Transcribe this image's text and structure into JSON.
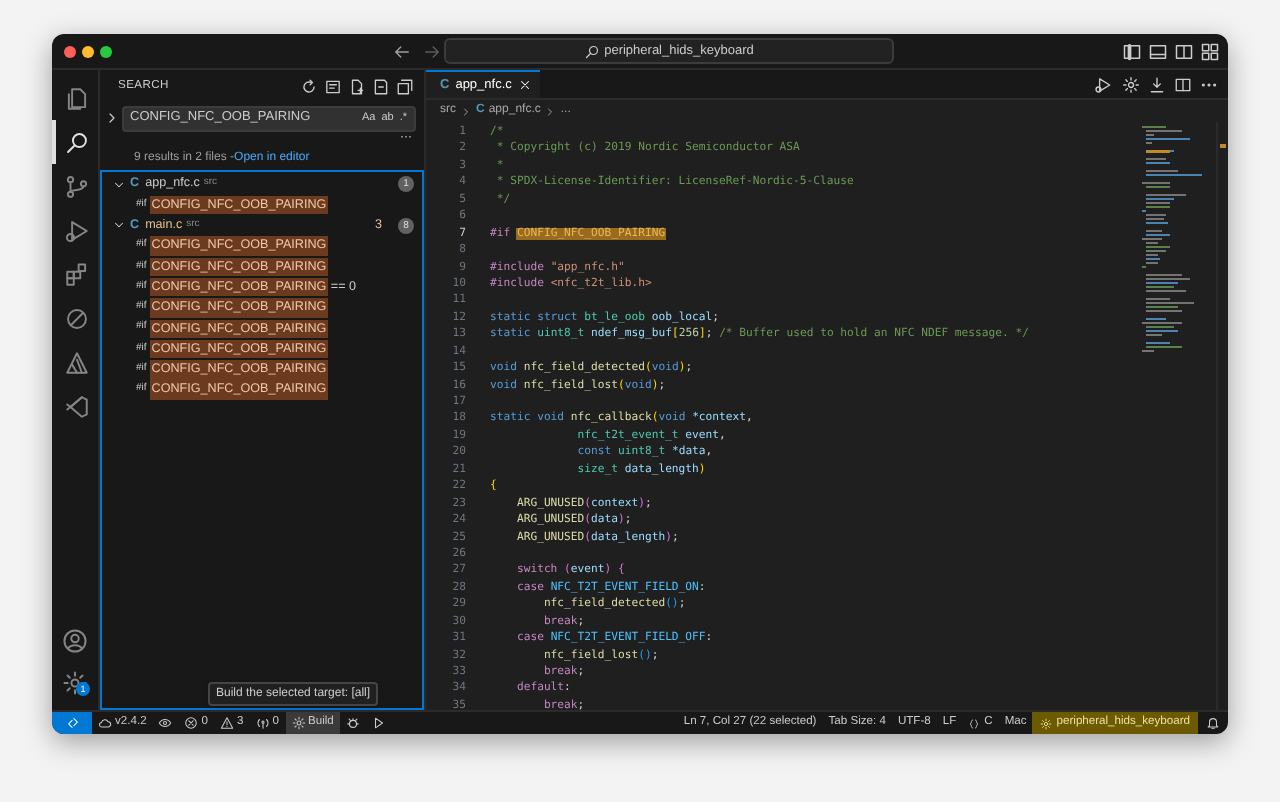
{
  "title_bar": {
    "search": "peripheral_hids_keyboard"
  },
  "activity_bar": {
    "items": [
      {
        "kind": "files",
        "selected": false
      },
      {
        "kind": "search",
        "selected": true
      },
      {
        "kind": "source-control",
        "selected": false
      },
      {
        "kind": "run-debug",
        "selected": false
      },
      {
        "kind": "extensions",
        "selected": false
      },
      {
        "kind": "remote",
        "selected": false
      },
      {
        "kind": "triangle",
        "selected": false
      },
      {
        "kind": "ribbon",
        "selected": false
      }
    ],
    "account": {
      "kind": "account"
    },
    "settings": {
      "badge": "1"
    }
  },
  "sidebar": {
    "title": "SEARCH",
    "search": {
      "replace_expanded": false,
      "value": "CONFIG_NFC_OOB_PAIRING",
      "options": [
        "Aa",
        "ab",
        ".*"
      ]
    },
    "more": "···",
    "summary": "9 results in 2 files - ",
    "open_link": "Open in editor",
    "results": [
      {
        "file_icon": "C",
        "file": "app_nfc.c",
        "folder": "src",
        "modified": false,
        "count": "1",
        "expanded": true,
        "matches": [
          {
            "prefix": "#if",
            "match": "CONFIG_NFC_OOB_PAIRING"
          }
        ]
      },
      {
        "file_icon": "C",
        "file": "main.c",
        "folder": "src",
        "modified": true,
        "problems": "3",
        "count": "8",
        "expanded": true,
        "matches": [
          {
            "prefix": "#if",
            "match": "CONFIG_NFC_OOB_PAIRING"
          },
          {
            "prefix": "#if",
            "match": "CONFIG_NFC_OOB_PAIRING"
          },
          {
            "prefix": "#if",
            "match": "CONFIG_NFC_OOB_PAIRING",
            "suffix": " == 0"
          },
          {
            "prefix": "#if",
            "match": "CONFIG_NFC_OOB_PAIRING"
          },
          {
            "prefix": "#if",
            "match": "CONFIG_NFC_OOB_PAIRING"
          },
          {
            "prefix": "#if",
            "match": "CONFIG_NFC_OOB_PAIRING"
          },
          {
            "prefix": "#if",
            "match": "CONFIG_NFC_OOB_PAIRING"
          },
          {
            "prefix": "#if",
            "match": "CONFIG_NFC_OOB_PAIRING"
          }
        ]
      }
    ]
  },
  "editor": {
    "tabs": [
      {
        "file_icon": "C",
        "label": "app_nfc.c",
        "selected": true
      }
    ],
    "breadcrumbs": [
      {
        "kind": "folder",
        "text": "src"
      },
      {
        "kind": "file",
        "icon": "C",
        "text": "app_nfc.c"
      },
      {
        "kind": "more",
        "text": "..."
      }
    ],
    "lines": [
      {
        "number": "1",
        "current": false,
        "tokens": [
          {
            "text": "/*",
            "kind": "comment"
          }
        ]
      },
      {
        "number": "2",
        "current": false,
        "tokens": [
          {
            "text": " * Copyright (c) 2019 Nordic Semiconductor ASA",
            "kind": "comment"
          }
        ]
      },
      {
        "number": "3",
        "current": false,
        "tokens": [
          {
            "text": " *",
            "kind": "comment"
          }
        ]
      },
      {
        "number": "4",
        "current": false,
        "tokens": [
          {
            "text": " * SPDX-License-Identifier: LicenseRef-Nordic-5-Clause",
            "kind": "comment"
          }
        ]
      },
      {
        "number": "5",
        "current": false,
        "tokens": [
          {
            "text": " */",
            "kind": "comment"
          }
        ]
      },
      {
        "number": "6",
        "current": false
      },
      {
        "number": "7",
        "current": true,
        "tokens": [
          {
            "text": "#if ",
            "kind": "directive"
          },
          {
            "text": "CONFIG_NFC_OOB_PAIRING",
            "kind": "match"
          }
        ]
      },
      {
        "number": "8",
        "current": false
      },
      {
        "number": "9",
        "current": false,
        "tokens": [
          {
            "text": "#include ",
            "kind": "directive"
          },
          {
            "text": "\"app_nfc.h\"",
            "kind": "string"
          }
        ]
      },
      {
        "number": "10",
        "current": false,
        "tokens": [
          {
            "text": "#include ",
            "kind": "directive"
          },
          {
            "text": "<nfc_t2t_lib.h>",
            "kind": "string"
          }
        ]
      },
      {
        "number": "11",
        "current": false
      },
      {
        "number": "12",
        "current": false,
        "tokens": [
          {
            "text": "static struct ",
            "kind": "keyword"
          },
          {
            "text": "bt_le_oob ",
            "kind": "type"
          },
          {
            "text": "oob_local",
            "kind": "variable"
          },
          {
            "text": ";",
            "kind": "plain"
          }
        ]
      },
      {
        "number": "13",
        "current": false,
        "tokens": [
          {
            "text": "static ",
            "kind": "keyword"
          },
          {
            "text": "uint8_t ",
            "kind": "type"
          },
          {
            "text": "ndef_msg_buf",
            "kind": "variable"
          },
          {
            "text": "[",
            "kind": "bracket"
          },
          {
            "text": "256",
            "kind": "number"
          },
          {
            "text": "]",
            "kind": "bracket"
          },
          {
            "text": "; ",
            "kind": "plain"
          },
          {
            "text": "/* Buffer used to hold an NFC NDEF message. */",
            "kind": "comment"
          }
        ]
      },
      {
        "number": "14",
        "current": false
      },
      {
        "number": "15",
        "current": false,
        "tokens": [
          {
            "text": "void ",
            "kind": "keyword"
          },
          {
            "text": "nfc_field_detected",
            "kind": "function"
          },
          {
            "text": "(",
            "kind": "bracket"
          },
          {
            "text": "void",
            "kind": "keyword"
          },
          {
            "text": ")",
            "kind": "bracket"
          },
          {
            "text": ";",
            "kind": "plain"
          }
        ]
      },
      {
        "number": "16",
        "current": false,
        "tokens": [
          {
            "text": "void ",
            "kind": "keyword"
          },
          {
            "text": "nfc_field_lost",
            "kind": "function"
          },
          {
            "text": "(",
            "kind": "bracket"
          },
          {
            "text": "void",
            "kind": "keyword"
          },
          {
            "text": ")",
            "kind": "bracket"
          },
          {
            "text": ";",
            "kind": "plain"
          }
        ]
      },
      {
        "number": "17",
        "current": false
      },
      {
        "number": "18",
        "current": false,
        "tokens": [
          {
            "text": "static void ",
            "kind": "keyword"
          },
          {
            "text": "nfc_callback",
            "kind": "function"
          },
          {
            "text": "(",
            "kind": "bracket"
          },
          {
            "text": "void ",
            "kind": "keyword"
          },
          {
            "text": "*context",
            "kind": "variable"
          },
          {
            "text": ",",
            "kind": "plain"
          }
        ]
      },
      {
        "number": "19",
        "current": false,
        "tokens": [
          {
            "text": "             nfc_t2t_event_t ",
            "kind": "type"
          },
          {
            "text": "event",
            "kind": "variable"
          },
          {
            "text": ",",
            "kind": "plain"
          }
        ]
      },
      {
        "number": "20",
        "current": false,
        "tokens": [
          {
            "text": "             const ",
            "kind": "keyword"
          },
          {
            "text": "uint8_t ",
            "kind": "type"
          },
          {
            "text": "*data",
            "kind": "variable"
          },
          {
            "text": ",",
            "kind": "plain"
          }
        ]
      },
      {
        "number": "21",
        "current": false,
        "tokens": [
          {
            "text": "             size_t ",
            "kind": "type"
          },
          {
            "text": "data_length",
            "kind": "variable"
          },
          {
            "text": ")",
            "kind": "bracket"
          }
        ]
      },
      {
        "number": "22",
        "current": false,
        "tokens": [
          {
            "text": "{",
            "kind": "bracket"
          }
        ]
      },
      {
        "number": "23",
        "current": false,
        "tokens": [
          {
            "text": "    ARG_UNUSED",
            "kind": "function"
          },
          {
            "text": "(",
            "kind": "bracket2"
          },
          {
            "text": "context",
            "kind": "variable"
          },
          {
            "text": ")",
            "kind": "bracket2"
          },
          {
            "text": ";",
            "kind": "plain"
          }
        ]
      },
      {
        "number": "24",
        "current": false,
        "tokens": [
          {
            "text": "    ARG_UNUSED",
            "kind": "function"
          },
          {
            "text": "(",
            "kind": "bracket2"
          },
          {
            "text": "data",
            "kind": "variable"
          },
          {
            "text": ")",
            "kind": "bracket2"
          },
          {
            "text": ";",
            "kind": "plain"
          }
        ]
      },
      {
        "number": "25",
        "current": false,
        "tokens": [
          {
            "text": "    ARG_UNUSED",
            "kind": "function"
          },
          {
            "text": "(",
            "kind": "bracket2"
          },
          {
            "text": "data_length",
            "kind": "variable"
          },
          {
            "text": ")",
            "kind": "bracket2"
          },
          {
            "text": ";",
            "kind": "plain"
          }
        ]
      },
      {
        "number": "26",
        "current": false
      },
      {
        "number": "27",
        "current": false,
        "tokens": [
          {
            "text": "    switch ",
            "kind": "control"
          },
          {
            "text": "(",
            "kind": "bracket2"
          },
          {
            "text": "event",
            "kind": "variable"
          },
          {
            "text": ") ",
            "kind": "bracket2"
          },
          {
            "text": "{",
            "kind": "bracket2"
          }
        ]
      },
      {
        "number": "28",
        "current": false,
        "tokens": [
          {
            "text": "    case ",
            "kind": "control"
          },
          {
            "text": "NFC_T2T_EVENT_FIELD_ON",
            "kind": "constant"
          },
          {
            "text": ":",
            "kind": "plain"
          }
        ]
      },
      {
        "number": "29",
        "current": false,
        "tokens": [
          {
            "text": "        nfc_field_detected",
            "kind": "function"
          },
          {
            "text": "()",
            "kind": "bracket3"
          },
          {
            "text": ";",
            "kind": "plain"
          }
        ]
      },
      {
        "number": "30",
        "current": false,
        "tokens": [
          {
            "text": "        break",
            "kind": "control"
          },
          {
            "text": ";",
            "kind": "plain"
          }
        ]
      },
      {
        "number": "31",
        "current": false,
        "tokens": [
          {
            "text": "    case ",
            "kind": "control"
          },
          {
            "text": "NFC_T2T_EVENT_FIELD_OFF",
            "kind": "constant"
          },
          {
            "text": ":",
            "kind": "plain"
          }
        ]
      },
      {
        "number": "32",
        "current": false,
        "tokens": [
          {
            "text": "        nfc_field_lost",
            "kind": "function"
          },
          {
            "text": "()",
            "kind": "bracket3"
          },
          {
            "text": ";",
            "kind": "plain"
          }
        ]
      },
      {
        "number": "33",
        "current": false,
        "tokens": [
          {
            "text": "        break",
            "kind": "control"
          },
          {
            "text": ";",
            "kind": "plain"
          }
        ]
      },
      {
        "number": "34",
        "current": false,
        "tokens": [
          {
            "text": "    default",
            "kind": "control"
          },
          {
            "text": ":",
            "kind": "plain"
          }
        ]
      },
      {
        "number": "35",
        "current": false,
        "tokens": [
          {
            "text": "        break",
            "kind": "control"
          },
          {
            "text": ";",
            "kind": "plain"
          }
        ]
      }
    ]
  },
  "tooltip": "Build the selected target: [all]",
  "status_bar": {
    "left": [
      {
        "kind": "remote",
        "hovered": false
      },
      {
        "kind": "sdk",
        "text": "v2.4.2",
        "hovered": false
      },
      {
        "kind": "eye",
        "hovered": false
      },
      {
        "kind": "errors",
        "text": "0",
        "hovered": false
      },
      {
        "kind": "warnings",
        "text": "3",
        "hovered": false
      },
      {
        "kind": "ports",
        "text": "0",
        "hovered": false
      },
      {
        "kind": "build",
        "text": "Build",
        "hovered": true
      },
      {
        "kind": "debug",
        "hovered": false
      },
      {
        "kind": "run",
        "hovered": false
      }
    ],
    "right": [
      {
        "kind": "text",
        "text": "Ln 7, Col 27 (22 selected)"
      },
      {
        "kind": "text",
        "text": "Tab Size: 4"
      },
      {
        "kind": "text",
        "text": "UTF-8"
      },
      {
        "kind": "text",
        "text": "LF"
      },
      {
        "kind": "language",
        "text": "C"
      },
      {
        "kind": "text",
        "text": "Mac"
      },
      {
        "kind": "project",
        "text": "peripheral_hids_keyboard"
      },
      {
        "kind": "bell"
      }
    ]
  }
}
